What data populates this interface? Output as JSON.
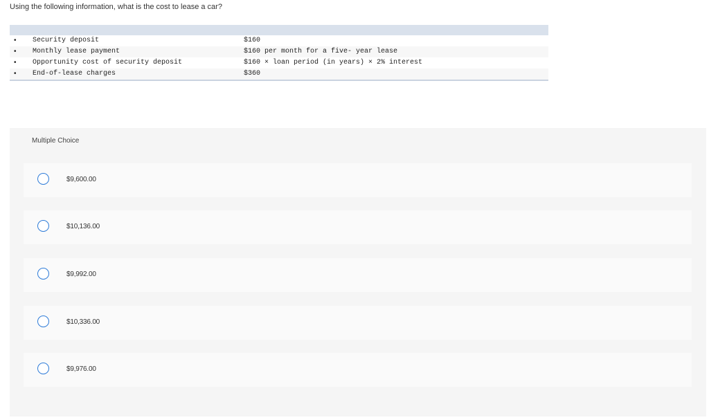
{
  "question": "Using the following information, what is the cost to lease a car?",
  "info_rows": [
    {
      "bullet": "•",
      "label": "Security deposit",
      "value": "$160"
    },
    {
      "bullet": "•",
      "label": "Monthly lease payment",
      "value": "$160 per month for a five- year lease"
    },
    {
      "bullet": "•",
      "label": "Opportunity cost of security deposit",
      "value": "$160 × loan period (in years) × 2% interest"
    },
    {
      "bullet": "•",
      "label": "End-of-lease charges",
      "value": "$360"
    }
  ],
  "multiple_choice": {
    "title": "Multiple Choice",
    "options": [
      {
        "label": "$9,600.00"
      },
      {
        "label": "$10,136.00"
      },
      {
        "label": "$9,992.00"
      },
      {
        "label": "$10,336.00"
      },
      {
        "label": "$9,976.00"
      }
    ]
  },
  "colors": {
    "radio_accent": "#2d7bd8",
    "table_header": "#d9e1ec",
    "panel_background": "#f5f5f5"
  }
}
